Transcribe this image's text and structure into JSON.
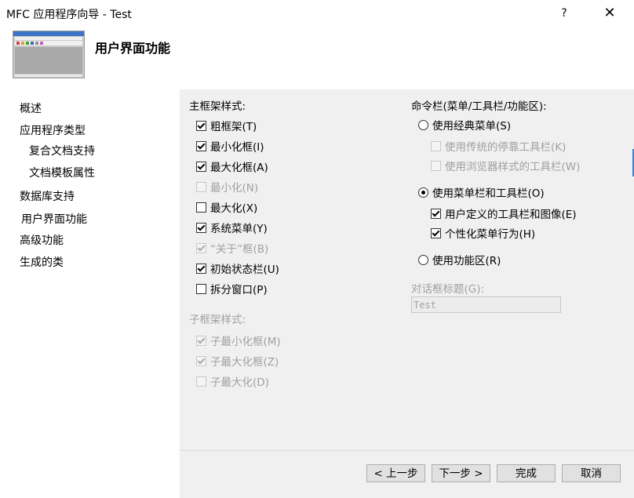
{
  "window": {
    "title": "MFC 应用程序向导 - Test",
    "help_label": "?",
    "close_label": "✕"
  },
  "header": {
    "title": "用户界面功能",
    "thumbnail_icon": "app-window-preview-icon"
  },
  "nav": {
    "items": [
      {
        "label": "概述"
      },
      {
        "label": "应用程序类型"
      },
      {
        "label": "复合文档支持"
      },
      {
        "label": "文档模板属性"
      },
      {
        "label": "数据库支持"
      },
      {
        "label": "用户界面功能",
        "selected": true
      },
      {
        "label": "高级功能"
      },
      {
        "label": "生成的类"
      }
    ]
  },
  "main_frame": {
    "heading": "主框架样式:",
    "options": [
      {
        "label": "粗框架(T)",
        "checked": true,
        "enabled": true
      },
      {
        "label": "最小化框(I)",
        "checked": true,
        "enabled": true
      },
      {
        "label": "最大化框(A)",
        "checked": true,
        "enabled": true
      },
      {
        "label": "最小化(N)",
        "checked": false,
        "enabled": false
      },
      {
        "label": "最大化(X)",
        "checked": false,
        "enabled": true
      },
      {
        "label": "系统菜单(Y)",
        "checked": true,
        "enabled": true
      },
      {
        "label": "“关于”框(B)",
        "checked": true,
        "enabled": false
      },
      {
        "label": "初始状态栏(U)",
        "checked": true,
        "enabled": true
      },
      {
        "label": "拆分窗口(P)",
        "checked": false,
        "enabled": true
      }
    ]
  },
  "child_frame": {
    "heading": "子框架样式:",
    "options": [
      {
        "label": "子最小化框(M)",
        "checked": true,
        "enabled": false
      },
      {
        "label": "子最大化框(Z)",
        "checked": true,
        "enabled": false
      },
      {
        "label": "子最大化(D)",
        "checked": false,
        "enabled": false
      }
    ]
  },
  "command_bar": {
    "heading": "命令栏(菜单/工具栏/功能区):",
    "classic": {
      "label": "使用经典菜单(S)",
      "selected": false
    },
    "classic_sub": [
      {
        "label": "使用传统的停靠工具栏(K)",
        "checked": false,
        "enabled": false
      },
      {
        "label": "使用浏览器样式的工具栏(W)",
        "checked": false,
        "enabled": false
      }
    ],
    "menubar": {
      "label": "使用菜单栏和工具栏(O)",
      "selected": true
    },
    "menubar_sub": [
      {
        "label": "用户定义的工具栏和图像(E)",
        "checked": true,
        "enabled": true
      },
      {
        "label": "个性化菜单行为(H)",
        "checked": true,
        "enabled": true
      }
    ],
    "ribbon": {
      "label": "使用功能区(R)",
      "selected": false
    }
  },
  "dialog_title": {
    "label": "对话框标题(G):",
    "value": "Test"
  },
  "buttons": {
    "prev": "< 上一步",
    "next": "下一步 >",
    "finish": "完成",
    "cancel": "取消"
  }
}
